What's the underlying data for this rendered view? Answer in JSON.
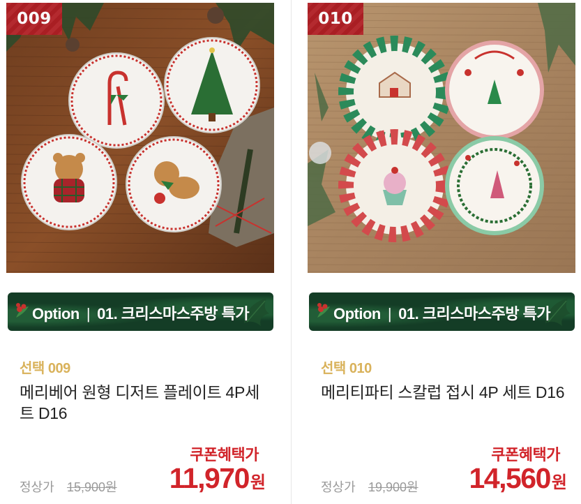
{
  "products": [
    {
      "badge": "009",
      "option_label": "Option",
      "option_separator": "|",
      "option_category": "01. 크리스마스주방 특가",
      "select_code": "선택 009",
      "title": "메리베어 원형 디저트 플레이트 4P세트 D16",
      "coupon_label": "쿠폰혜택가",
      "regular_label": "정상가",
      "regular_price": "15,900원",
      "sale_price": "11,970",
      "currency": "원"
    },
    {
      "badge": "010",
      "option_label": "Option",
      "option_separator": "|",
      "option_category": "01. 크리스마스주방 특가",
      "select_code": "선택 010",
      "title": "메리티파티 스칼럽 접시 4P 세트 D16",
      "coupon_label": "쿠폰혜택가",
      "regular_label": "정상가",
      "regular_price": "19,900원",
      "sale_price": "14,560",
      "currency": "원"
    }
  ],
  "colors": {
    "badge_bg": "#b01f24",
    "option_bar_bg": "#143d26",
    "select_code": "#d9b25b",
    "price_red": "#d1242a",
    "muted_gray": "#999999"
  }
}
